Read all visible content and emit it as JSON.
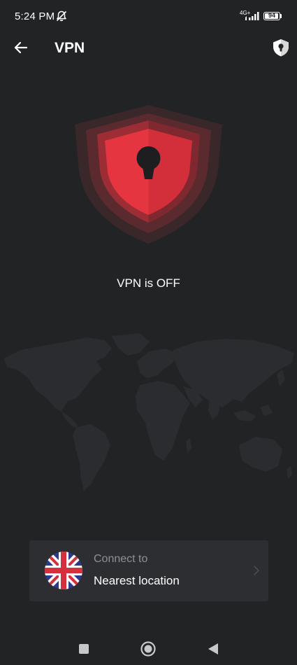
{
  "status_bar": {
    "time": "5:24 PM",
    "network": "4G+",
    "battery": "94",
    "battery_level": 0.94,
    "icons": [
      "bell-muted-icon",
      "signal-icon",
      "battery-icon"
    ]
  },
  "header": {
    "title": "VPN",
    "back_icon": "arrow-left-icon",
    "action_icon": "shield-lock-icon"
  },
  "hero": {
    "icon": "shield-keyhole-icon",
    "status_text": "VPN is OFF"
  },
  "connect_card": {
    "label": "Connect to",
    "location": "Nearest location",
    "flag_icon": "uk-flag-icon",
    "chevron_icon": "chevron-right-icon"
  },
  "nav_bar": {
    "icons": [
      "recents-square-icon",
      "home-circle-icon",
      "back-triangle-icon"
    ]
  },
  "colors": {
    "background": "#222325",
    "card": "#2d2e31",
    "accent_red": "#e53540",
    "muted_text": "#8f9094"
  }
}
